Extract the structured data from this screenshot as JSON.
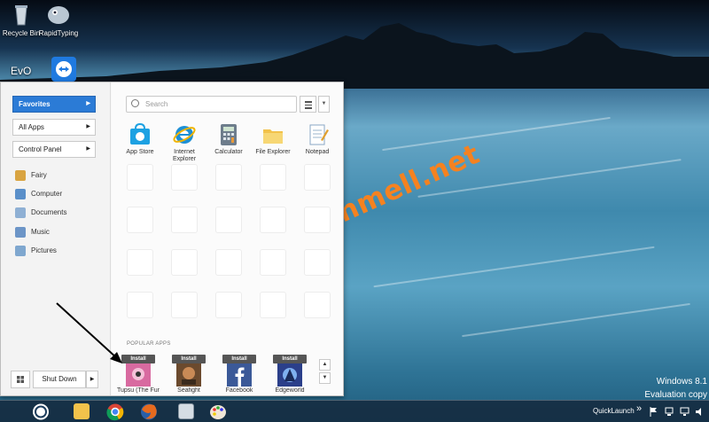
{
  "desktop": {
    "icons": [
      {
        "label": "Recycle Bin",
        "icon": "recycle-bin-icon"
      },
      {
        "label": "RapidTyping",
        "icon": "rapidtyping-icon"
      },
      {
        "label": "",
        "icon": "evo-icon"
      },
      {
        "label": "",
        "icon": "teamviewer-icon"
      }
    ],
    "watermark": "techmell.net",
    "os_name": "Windows 8.1",
    "os_note": "Evaluation copy"
  },
  "start_menu": {
    "nav": [
      {
        "label": "Favorites",
        "active": true
      },
      {
        "label": "All Apps",
        "active": false
      },
      {
        "label": "Control Panel",
        "active": false
      }
    ],
    "places": [
      {
        "label": "Fairy",
        "icon": "user-icon"
      },
      {
        "label": "Computer",
        "icon": "computer-icon"
      },
      {
        "label": "Documents",
        "icon": "documents-icon"
      },
      {
        "label": "Music",
        "icon": "music-icon"
      },
      {
        "label": "Pictures",
        "icon": "pictures-icon"
      }
    ],
    "shutdown_label": "Shut Down",
    "search_placeholder": "Search",
    "apps": [
      {
        "label": "App Store",
        "icon": "app-store-icon"
      },
      {
        "label": "Internet Explorer",
        "icon": "internet-explorer-icon"
      },
      {
        "label": "Calculator",
        "icon": "calculator-icon"
      },
      {
        "label": "File Explorer",
        "icon": "file-explorer-icon"
      },
      {
        "label": "Notepad",
        "icon": "notepad-icon"
      }
    ],
    "popular_title": "POPULAR APPS",
    "install_label": "Install",
    "popular": [
      {
        "label": "Tupsu (The Fur",
        "icon": "tupsu-icon"
      },
      {
        "label": "Seafight",
        "icon": "seafight-icon"
      },
      {
        "label": "Facebook",
        "icon": "facebook-icon"
      },
      {
        "label": "Edgeworld",
        "icon": "edgeworld-icon"
      }
    ]
  },
  "taskbar": {
    "items": [
      {
        "name": "file-explorer-taskbar",
        "icon": "folder-icon"
      },
      {
        "name": "chrome-taskbar",
        "icon": "chrome-icon"
      },
      {
        "name": "firefox-taskbar",
        "icon": "firefox-icon"
      },
      {
        "name": "files-taskbar",
        "icon": "documents-icon"
      },
      {
        "name": "paint-taskbar",
        "icon": "paint-icon"
      }
    ],
    "quicklaunch_label": "QuickLaunch",
    "chevron": "»"
  },
  "colors": {
    "accent": "#2b7bd6",
    "watermark": "#f58220",
    "install_badge": "#555555"
  }
}
